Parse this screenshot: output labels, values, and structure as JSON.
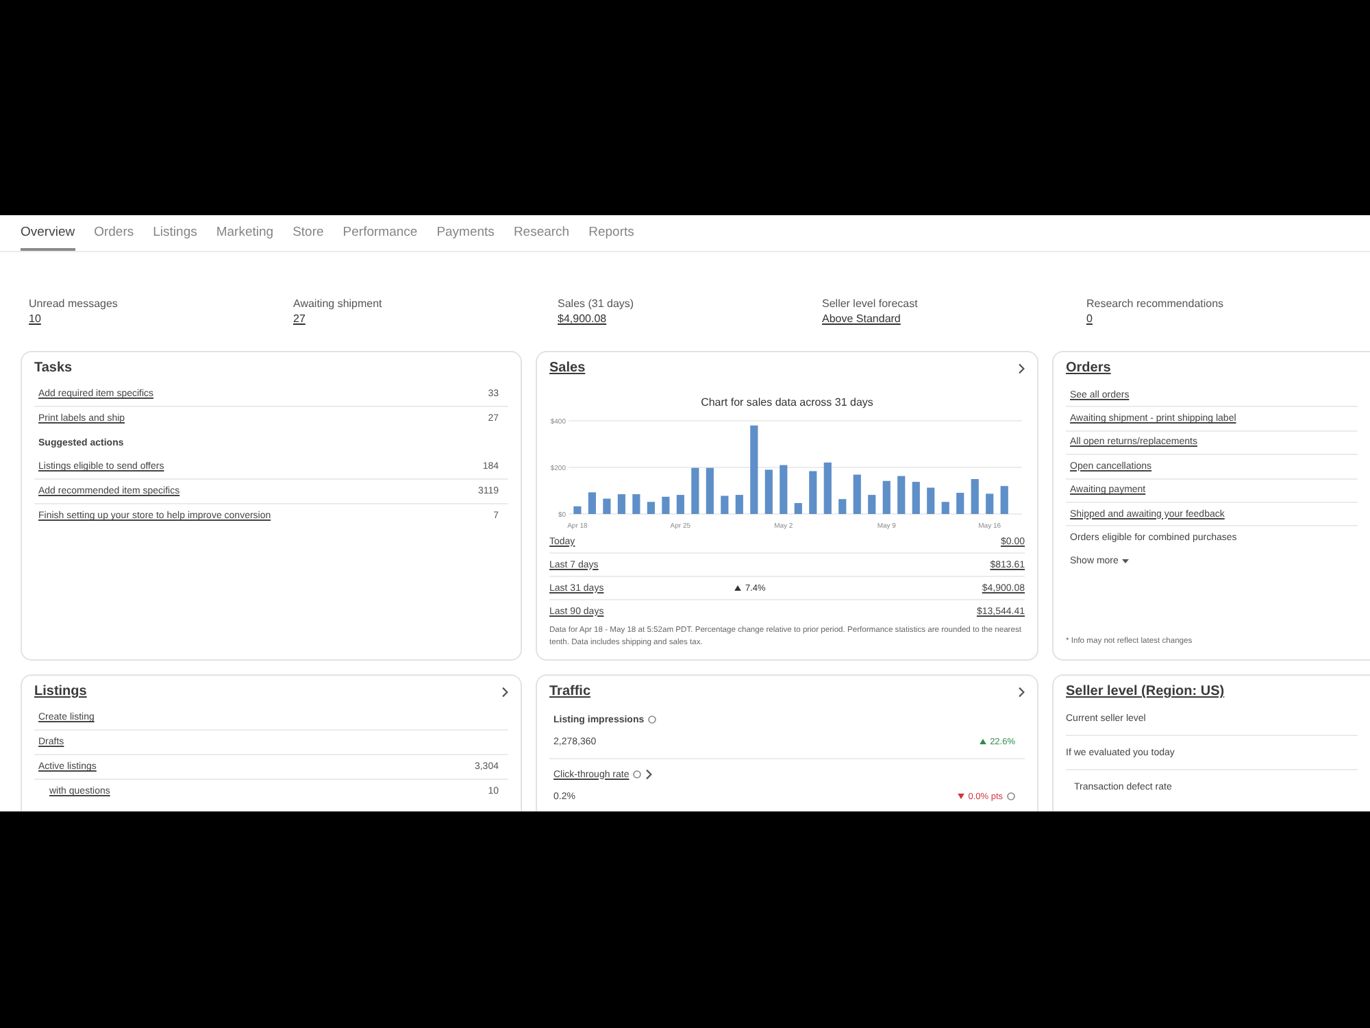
{
  "tabs": [
    {
      "label": "Overview",
      "selected": true
    },
    {
      "label": "Orders",
      "selected": false
    },
    {
      "label": "Listings",
      "selected": false
    },
    {
      "label": "Marketing",
      "selected": false
    },
    {
      "label": "Store",
      "selected": false
    },
    {
      "label": "Performance",
      "selected": false
    },
    {
      "label": "Payments",
      "selected": false
    },
    {
      "label": "Research",
      "selected": false
    },
    {
      "label": "Reports",
      "selected": false
    }
  ],
  "summary": [
    {
      "label": "Unread messages",
      "value": "10"
    },
    {
      "label": "Awaiting shipment",
      "value": "27"
    },
    {
      "label": "Sales (31 days)",
      "value": "$4,900.08"
    },
    {
      "label": "Seller level forecast",
      "value": "Above Standard"
    },
    {
      "label": "Research recommendations",
      "value": "0"
    }
  ],
  "tasks": {
    "title": "Tasks",
    "items": [
      {
        "label": "Add required item specifics",
        "count": "33"
      },
      {
        "label": "Print labels and ship",
        "count": "27"
      }
    ],
    "suggested_heading": "Suggested actions",
    "suggested": [
      {
        "label": "Listings eligible to send offers",
        "count": "184"
      },
      {
        "label": "Add recommended item specifics",
        "count": "3119"
      },
      {
        "label": "Finish setting up your store to help improve conversion",
        "count": "7"
      }
    ]
  },
  "sales": {
    "title": "Sales",
    "chart_data": {
      "type": "bar",
      "title": "Chart for sales data across 31 days",
      "categories": [
        "Apr 18",
        null,
        null,
        null,
        null,
        null,
        null,
        "Apr 25",
        null,
        null,
        null,
        null,
        null,
        null,
        "May 2",
        null,
        null,
        null,
        null,
        null,
        null,
        "May 9",
        null,
        null,
        null,
        null,
        null,
        null,
        "May 16",
        null
      ],
      "values": [
        33,
        93,
        66,
        85,
        85,
        52,
        74,
        82,
        198,
        198,
        78,
        82,
        380,
        190,
        210,
        47,
        184,
        221,
        64,
        169,
        82,
        142,
        163,
        138,
        113,
        52,
        91,
        150,
        87,
        120
      ],
      "ylim": [
        0,
        400
      ],
      "yticks": [
        {
          "value": 0,
          "label": "$0"
        },
        {
          "value": 200,
          "label": "$200"
        },
        {
          "value": 400,
          "label": "$400"
        }
      ]
    },
    "periods": [
      {
        "label": "Today",
        "value": "$0.00"
      },
      {
        "label": "Last 7 days",
        "value": "$813.61"
      },
      {
        "label": "Last 31 days",
        "change": {
          "up": true,
          "text": "7.4%"
        },
        "value": "$4,900.08"
      },
      {
        "label": "Last 90 days",
        "value": "$13,544.41"
      }
    ],
    "note": "Data for Apr 18 - May 18 at 5:52am PDT. Percentage change relative to prior period. Performance statistics are rounded to the nearest tenth. Data includes shipping and sales tax."
  },
  "orders": {
    "title": "Orders",
    "items": [
      {
        "label": "See all orders",
        "kind": "link"
      },
      {
        "label": "Awaiting shipment - print shipping label",
        "kind": "link"
      },
      {
        "label": "All open returns/replacements",
        "kind": "link"
      },
      {
        "label": "Open cancellations",
        "kind": "link"
      },
      {
        "label": "Awaiting payment",
        "kind": "link"
      },
      {
        "label": "Shipped and awaiting your feedback",
        "kind": "link"
      },
      {
        "label": "Orders eligible for combined purchases",
        "kind": "text"
      }
    ],
    "show_more": "Show more",
    "note": "* Info may not reflect latest changes"
  },
  "listings": {
    "title": "Listings",
    "items": [
      {
        "label": "Create listing",
        "kind": "link"
      },
      {
        "label": "Drafts",
        "kind": "link"
      },
      {
        "label": "Active listings",
        "count": "3,304",
        "kind": "link"
      },
      {
        "label": "with questions",
        "count": "10",
        "kind": "sub"
      }
    ]
  },
  "traffic": {
    "title": "Traffic",
    "metrics": [
      {
        "label": "Listing impressions",
        "value": "2,278,360",
        "change": {
          "up": true,
          "text": "22.6%"
        },
        "kind": "stat"
      },
      {
        "label": "Click-through rate",
        "value": "0.2%",
        "change": {
          "up": false,
          "text": "0.0% pts"
        },
        "kind": "link"
      }
    ]
  },
  "seller_level": {
    "title": "Seller level (Region: US)",
    "rows": [
      {
        "label": "Current seller level",
        "kind": "row"
      },
      {
        "label": "If we evaluated you today",
        "kind": "row"
      },
      {
        "label": "Transaction defect rate",
        "kind": "metric"
      }
    ]
  }
}
